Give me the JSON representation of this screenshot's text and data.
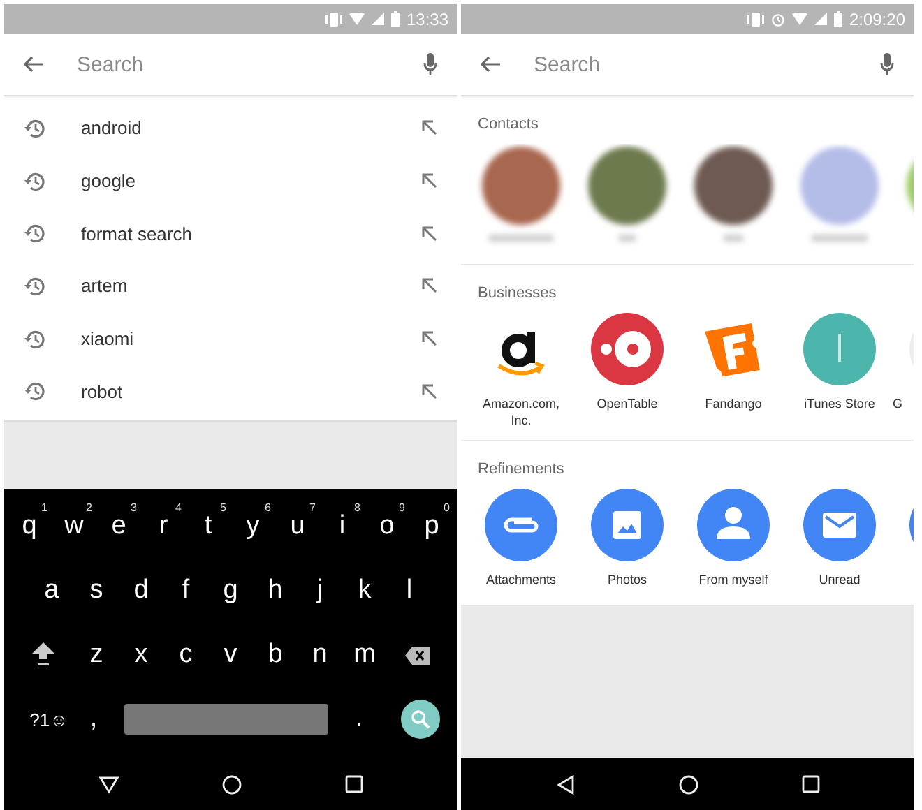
{
  "left_phone": {
    "status_bar": {
      "time": "13:33"
    },
    "search": {
      "placeholder": "Search"
    },
    "history": [
      {
        "text": "android"
      },
      {
        "text": "google"
      },
      {
        "text": "format search"
      },
      {
        "text": "artem"
      },
      {
        "text": "xiaomi"
      },
      {
        "text": "robot"
      }
    ],
    "keyboard": {
      "letter_rows": [
        {
          "keys": [
            {
              "label": "q",
              "hint": "1"
            },
            {
              "label": "w",
              "hint": "2"
            },
            {
              "label": "e",
              "hint": "3"
            },
            {
              "label": "r",
              "hint": "4"
            },
            {
              "label": "t",
              "hint": "5"
            },
            {
              "label": "y",
              "hint": "6"
            },
            {
              "label": "u",
              "hint": "7"
            },
            {
              "label": "i",
              "hint": "8"
            },
            {
              "label": "o",
              "hint": "9"
            },
            {
              "label": "p",
              "hint": "0"
            }
          ]
        },
        {
          "keys": [
            {
              "label": "a"
            },
            {
              "label": "s"
            },
            {
              "label": "d"
            },
            {
              "label": "f"
            },
            {
              "label": "g"
            },
            {
              "label": "h"
            },
            {
              "label": "j"
            },
            {
              "label": "k"
            },
            {
              "label": "l"
            }
          ]
        },
        {
          "keys": [
            {
              "label": "z"
            },
            {
              "label": "x"
            },
            {
              "label": "c"
            },
            {
              "label": "v"
            },
            {
              "label": "b"
            },
            {
              "label": "n"
            },
            {
              "label": "m"
            }
          ]
        }
      ],
      "symbols_key": "?1☺",
      "comma_key": ",",
      "period_key": "."
    }
  },
  "right_phone": {
    "status_bar": {
      "time": "2:09:20"
    },
    "search": {
      "placeholder": "Search"
    },
    "contacts": {
      "title": "Contacts",
      "items": [
        {
          "color": "#a8674f"
        },
        {
          "color": "#6d7a4e"
        },
        {
          "color": "#6e5a52"
        },
        {
          "color": "#b4bce8"
        },
        {
          "color": "#9ccc65"
        }
      ]
    },
    "businesses": {
      "title": "Businesses",
      "items": [
        {
          "kind": "amazon",
          "label": "Amazon.com, Inc."
        },
        {
          "kind": "opentable",
          "label": "OpenTable"
        },
        {
          "kind": "fandango",
          "label": "Fandango"
        },
        {
          "kind": "itunes",
          "label": "iTunes Store"
        },
        {
          "kind": "partial",
          "label": "G"
        }
      ]
    },
    "refinements": {
      "title": "Refinements",
      "items": [
        {
          "kind": "attachments",
          "label": "Attachments"
        },
        {
          "kind": "photos",
          "label": "Photos"
        },
        {
          "kind": "from_me",
          "label": "From myself"
        },
        {
          "kind": "unread",
          "label": "Unread"
        },
        {
          "kind": "partial"
        }
      ]
    }
  }
}
